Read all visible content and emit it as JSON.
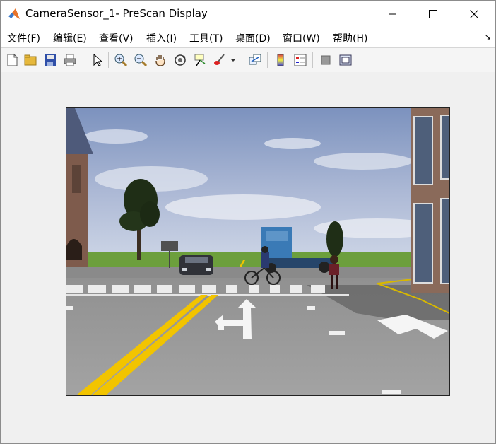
{
  "window": {
    "title": "CameraSensor_1- PreScan Display",
    "controls": {
      "minimize": "minimize-icon",
      "maximize": "maximize-icon",
      "close": "close-icon"
    }
  },
  "menu": {
    "items": [
      "文件(F)",
      "编辑(E)",
      "查看(V)",
      "插入(I)",
      "工具(T)",
      "桌面(D)",
      "窗口(W)",
      "帮助(H)"
    ],
    "corner_glyph": "↘"
  },
  "toolbar": {
    "icons": [
      "new-file-icon",
      "open-folder-icon",
      "save-icon",
      "print-icon",
      "select-pointer-icon",
      "zoom-in-icon",
      "zoom-out-icon",
      "pan-hand-icon",
      "rotate-3d-icon",
      "data-cursor-icon",
      "brush-icon",
      "link-plot-icon",
      "colorbar-icon",
      "legend-icon",
      "hide-plot-tools-icon",
      "show-plot-tools-icon"
    ]
  },
  "colors": {
    "window_bg": "#f0f0f0",
    "titlebar_bg": "#ffffff",
    "sky_top": "#7f95c0",
    "road": "#9a9a9a",
    "lane_yellow": "#f2c400",
    "grass": "#6a9e3a"
  }
}
